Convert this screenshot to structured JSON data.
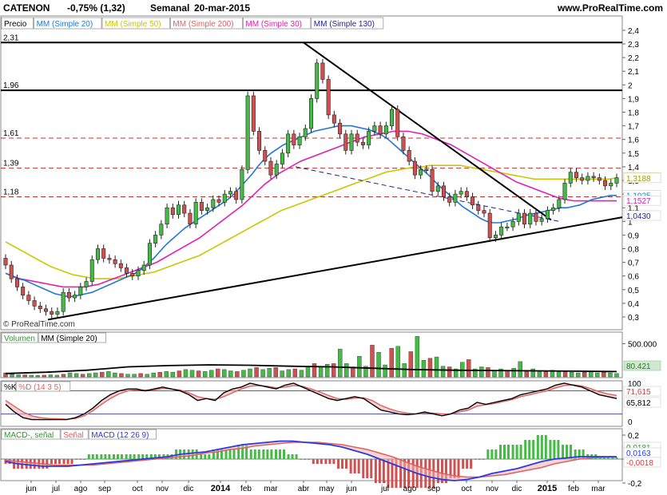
{
  "header": {
    "ticker": "CATENON",
    "change": "-0,75% (1,32)",
    "period": "Semanal",
    "date": "20-mar-2015",
    "site": "www.ProRealTime.com"
  },
  "price_legend": [
    {
      "label": "Precio",
      "color": "#000000"
    },
    {
      "label": "MM (Simple 20)",
      "color": "#1f78d6"
    },
    {
      "label": "MM (Simple 50)",
      "color": "#c8c800"
    },
    {
      "label": "MM (Simple 200)",
      "color": "#e06060"
    },
    {
      "label": "MM (Simple 30)",
      "color": "#e020b0"
    },
    {
      "label": "MM (Simple 130)",
      "color": "#2020a0"
    }
  ],
  "watermark": "© ProRealTime.com",
  "level_labels": [
    "2,31",
    "1,96",
    "1,61",
    "1,39",
    "1,18"
  ],
  "price_ticks": [
    "2,4",
    "2,3",
    "2,2",
    "2,1",
    "2",
    "1,9",
    "1,8",
    "1,7",
    "1,6",
    "1,5",
    "1,4",
    "1,3",
    "1,2",
    "1,1",
    "1",
    "0,9",
    "0,8",
    "0,7",
    "0,6",
    "0,5",
    "0,4",
    "0,3"
  ],
  "price_tags": [
    {
      "text": "1,32",
      "bg": "#f0e000",
      "fg": "#000000"
    },
    {
      "text": "1,3188",
      "bg": "#ffffff",
      "fg": "#a0a000"
    },
    {
      "text": "1,1925",
      "bg": "#ffffff",
      "fg": "#1f78d6"
    },
    {
      "text": "1,1527",
      "bg": "#ffffff",
      "fg": "#e020b0"
    },
    {
      "text": "1,0430",
      "bg": "#ffffff",
      "fg": "#2020a0"
    }
  ],
  "volume_panel": {
    "legend": [
      "Volumen",
      "MM (Simple 20)"
    ],
    "ticks": [
      "500.000"
    ],
    "tag": "80.421"
  },
  "stoch_panel": {
    "legend": [
      "%K",
      "%D (14 3 5)"
    ],
    "ticks": [
      "100",
      "0"
    ],
    "tags": [
      "71,615",
      "65,812"
    ]
  },
  "macd_panel": {
    "legend": [
      "MACD-, señal",
      "Señal",
      "MACD (12 26 9)"
    ],
    "ticks": [
      "0,2",
      "0",
      "-0,2"
    ],
    "tags": [
      "0,0181",
      "0,0163",
      "-0,0018"
    ]
  },
  "x_axis": [
    "jun",
    "jul",
    "ago",
    "sep",
    "oct",
    "nov",
    "dic",
    "2014",
    "feb",
    "mar",
    "abr",
    "may",
    "jun",
    "jul",
    "ago",
    "sep",
    "oct",
    "nov",
    "dic",
    "2015",
    "feb",
    "mar"
  ],
  "colors": {
    "up": "#44bb44",
    "down": "#d05050",
    "sma20": "#1f78d6",
    "sma50": "#c8c800",
    "sma30": "#e020b0",
    "sma200": "#e06060"
  },
  "chart_data": [
    {
      "type": "candlestick",
      "title": "CATENON -0,75% (1,32) Semanal 20-mar-2015",
      "ylim": [
        0.25,
        2.45
      ],
      "date_range": [
        "2013-06",
        "2015-03"
      ],
      "close": [
        0.68,
        0.58,
        0.52,
        0.46,
        0.42,
        0.38,
        0.36,
        0.34,
        0.32,
        0.34,
        0.48,
        0.44,
        0.46,
        0.52,
        0.56,
        0.72,
        0.8,
        0.73,
        0.72,
        0.69,
        0.66,
        0.62,
        0.6,
        0.64,
        0.68,
        0.84,
        0.9,
        0.98,
        1.1,
        1.05,
        1.12,
        1.06,
        0.98,
        1.14,
        1.08,
        1.1,
        1.16,
        1.14,
        1.2,
        1.22,
        1.16,
        1.38,
        1.92,
        1.66,
        1.52,
        1.44,
        1.34,
        1.42,
        1.5,
        1.64,
        1.56,
        1.62,
        1.68,
        1.9,
        2.16,
        2.04,
        1.78,
        1.72,
        1.64,
        1.52,
        1.64,
        1.58,
        1.56,
        1.66,
        1.7,
        1.64,
        1.7,
        1.82,
        1.62,
        1.52,
        1.44,
        1.34,
        1.38,
        1.38,
        1.22,
        1.26,
        1.18,
        1.14,
        1.2,
        1.22,
        1.18,
        1.12,
        1.08,
        1.06,
        0.88,
        0.9,
        0.96,
        0.96,
        1.0,
        1.06,
        0.98,
        1.06,
        1.0,
        1.02,
        1.08,
        1.1,
        1.16,
        1.28,
        1.36,
        1.32,
        1.3,
        1.33,
        1.32,
        1.3,
        1.26,
        1.28,
        1.32
      ],
      "sma20": [
        0.62,
        0.6,
        0.58,
        0.57,
        0.55,
        0.53,
        0.51,
        0.49,
        0.47,
        0.46,
        0.45,
        0.45,
        0.46,
        0.47,
        0.48,
        0.5,
        0.52,
        0.54,
        0.56,
        0.58,
        0.6,
        0.62,
        0.65,
        0.69,
        0.73,
        0.78,
        0.83,
        0.87,
        0.91,
        0.95,
        0.98,
        1.01,
        1.04,
        1.07,
        1.1,
        1.13,
        1.16,
        1.2,
        1.25,
        1.3,
        1.35,
        1.41,
        1.46,
        1.5,
        1.53,
        1.56,
        1.58,
        1.6,
        1.62,
        1.64,
        1.66,
        1.67,
        1.68,
        1.69,
        1.7,
        1.7,
        1.7,
        1.69,
        1.68,
        1.67,
        1.65,
        1.63,
        1.6,
        1.56,
        1.52,
        1.48,
        1.44,
        1.4,
        1.36,
        1.32,
        1.27,
        1.23,
        1.19,
        1.15,
        1.11,
        1.08,
        1.05,
        1.02,
        1.0,
        0.99,
        0.99,
        1.0,
        1.01,
        1.02,
        1.04,
        1.05,
        1.06,
        1.07,
        1.08,
        1.09,
        1.1,
        1.1,
        1.11,
        1.12,
        1.14,
        1.16,
        1.17,
        1.18,
        1.19,
        1.19
      ],
      "sma50": [
        0.85,
        0.82,
        0.79,
        0.76,
        0.73,
        0.7,
        0.67,
        0.65,
        0.63,
        0.61,
        0.6,
        0.59,
        0.58,
        0.58,
        0.58,
        0.58,
        0.59,
        0.6,
        0.61,
        0.62,
        0.63,
        0.65,
        0.67,
        0.69,
        0.71,
        0.73,
        0.75,
        0.78,
        0.81,
        0.84,
        0.87,
        0.9,
        0.93,
        0.96,
        0.99,
        1.02,
        1.05,
        1.08,
        1.1,
        1.12,
        1.14,
        1.16,
        1.18,
        1.2,
        1.22,
        1.24,
        1.26,
        1.28,
        1.3,
        1.32,
        1.34,
        1.36,
        1.37,
        1.38,
        1.39,
        1.4,
        1.4,
        1.41,
        1.41,
        1.41,
        1.41,
        1.41,
        1.4,
        1.39,
        1.38,
        1.37,
        1.36,
        1.35,
        1.34,
        1.33,
        1.32,
        1.31,
        1.31,
        1.31,
        1.31,
        1.31,
        1.31,
        1.31,
        1.31,
        1.31,
        1.31,
        1.31,
        1.32
      ],
      "sma30": [
        0.62,
        0.6,
        0.58,
        0.57,
        0.56,
        0.55,
        0.54,
        0.53,
        0.52,
        0.52,
        0.52,
        0.52,
        0.53,
        0.54,
        0.56,
        0.58,
        0.6,
        0.62,
        0.64,
        0.66,
        0.68,
        0.7,
        0.73,
        0.76,
        0.79,
        0.82,
        0.85,
        0.88,
        0.92,
        0.96,
        1.0,
        1.04,
        1.08,
        1.12,
        1.17,
        1.22,
        1.27,
        1.31,
        1.35,
        1.38,
        1.41,
        1.44,
        1.46,
        1.48,
        1.5,
        1.52,
        1.54,
        1.56,
        1.58,
        1.6,
        1.62,
        1.63,
        1.64,
        1.65,
        1.66,
        1.66,
        1.66,
        1.65,
        1.64,
        1.62,
        1.6,
        1.58,
        1.56,
        1.53,
        1.5,
        1.47,
        1.44,
        1.41,
        1.38,
        1.35,
        1.32,
        1.29,
        1.27,
        1.25,
        1.23,
        1.21,
        1.19,
        1.17,
        1.16,
        1.15,
        1.15,
        1.15,
        1.15,
        1.15,
        1.15,
        1.15
      ],
      "levels": [
        2.31,
        1.96,
        1.61,
        1.39,
        1.18
      ]
    },
    {
      "type": "bar",
      "title": "Volumen",
      "values": [
        60000,
        40000,
        30000,
        30000,
        25000,
        20000,
        25000,
        30000,
        25000,
        40000,
        60000,
        50000,
        40000,
        50000,
        60000,
        70000,
        80000,
        60000,
        50000,
        40000,
        40000,
        50000,
        40000,
        60000,
        70000,
        80000,
        70000,
        90000,
        110000,
        100000,
        90000,
        80000,
        100000,
        120000,
        110000,
        90000,
        80000,
        100000,
        120000,
        140000,
        110000,
        130000,
        140000,
        90000,
        110000,
        120000,
        100000,
        150000,
        200000,
        160000,
        190000,
        200000,
        420000,
        200000,
        150000,
        310000,
        160000,
        480000,
        370000,
        180000,
        430000,
        460000,
        200000,
        380000,
        610000,
        250000,
        280000,
        300000,
        160000,
        150000,
        120000,
        220000,
        260000,
        120000,
        150000,
        140000,
        100000,
        120000,
        100000,
        130000,
        230000,
        100000,
        120000,
        90000,
        80000,
        100000,
        90000,
        80000,
        70000,
        60000,
        70000,
        80000,
        60000,
        70000,
        60000,
        50000
      ],
      "ma20": [
        50000,
        70000,
        100000,
        150000,
        170000,
        180000,
        175000,
        160000,
        150000,
        130000,
        110000,
        100000,
        95000,
        90000,
        85000,
        80000
      ]
    },
    {
      "type": "line",
      "title": "%K %D (14 3 5)",
      "ylim": [
        0,
        100
      ],
      "k": [
        45,
        25,
        10,
        5,
        5,
        5,
        5,
        5,
        10,
        20,
        35,
        55,
        70,
        80,
        85,
        85,
        80,
        85,
        90,
        85,
        80,
        70,
        55,
        60,
        55,
        75,
        85,
        90,
        100,
        95,
        90,
        85,
        95,
        100,
        90,
        80,
        70,
        60,
        55,
        60,
        65,
        60,
        45,
        30,
        25,
        20,
        18,
        20,
        25,
        20,
        15,
        20,
        30,
        35,
        50,
        45,
        50,
        55,
        60,
        70,
        75,
        80,
        85,
        95,
        100,
        95,
        90,
        80,
        70,
        65,
        60
      ],
      "d": [
        55,
        40,
        25,
        15,
        10,
        8,
        7,
        6,
        8,
        15,
        28,
        45,
        60,
        72,
        80,
        82,
        82,
        83,
        86,
        85,
        82,
        75,
        65,
        60,
        58,
        65,
        75,
        85,
        92,
        94,
        92,
        88,
        90,
        94,
        92,
        85,
        77,
        68,
        60,
        58,
        61,
        62,
        55,
        42,
        33,
        26,
        22,
        20,
        22,
        22,
        20,
        20,
        25,
        30,
        40,
        44,
        47,
        52,
        57,
        65,
        70,
        75,
        80,
        88,
        94,
        96,
        93,
        86,
        78,
        72,
        68
      ]
    },
    {
      "type": "line",
      "title": "MACD (12 26 9)",
      "ylim": [
        -0.3,
        0.3
      ],
      "macd": [
        -0.02,
        -0.04,
        -0.05,
        -0.06,
        -0.06,
        -0.06,
        -0.05,
        -0.04,
        -0.03,
        -0.02,
        -0.01,
        0.0,
        0.01,
        0.02,
        0.04,
        0.05,
        0.06,
        0.08,
        0.1,
        0.12,
        0.13,
        0.14,
        0.15,
        0.15,
        0.14,
        0.13,
        0.12,
        0.1,
        0.07,
        0.04,
        0.0,
        -0.04,
        -0.08,
        -0.12,
        -0.15,
        -0.17,
        -0.18,
        -0.17,
        -0.15,
        -0.12,
        -0.1,
        -0.08,
        -0.05,
        -0.02,
        0.0,
        0.01,
        0.02,
        0.02,
        0.02,
        0.02
      ],
      "signal": [
        -0.01,
        -0.02,
        -0.03,
        -0.04,
        -0.05,
        -0.05,
        -0.05,
        -0.05,
        -0.04,
        -0.03,
        -0.02,
        -0.01,
        0.0,
        0.01,
        0.02,
        0.03,
        0.05,
        0.06,
        0.08,
        0.09,
        0.11,
        0.12,
        0.13,
        0.14,
        0.14,
        0.14,
        0.13,
        0.12,
        0.1,
        0.08,
        0.05,
        0.02,
        -0.02,
        -0.06,
        -0.09,
        -0.12,
        -0.14,
        -0.15,
        -0.15,
        -0.14,
        -0.13,
        -0.11,
        -0.09,
        -0.07,
        -0.04,
        -0.02,
        0.0,
        0.01,
        0.015,
        0.016
      ]
    }
  ]
}
